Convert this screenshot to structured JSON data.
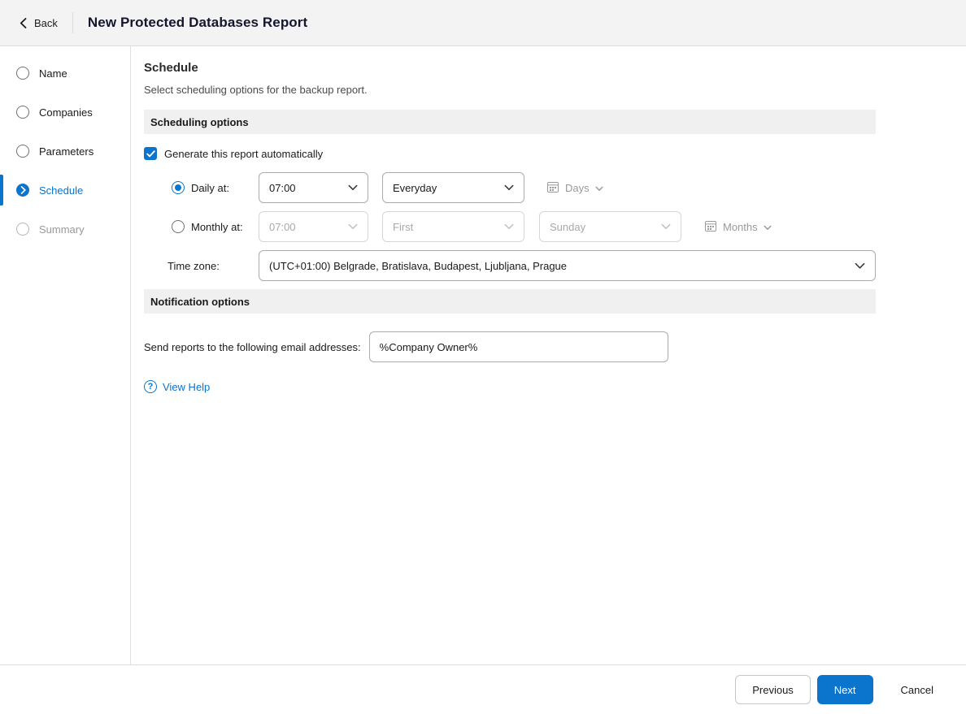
{
  "header": {
    "back_label": "Back",
    "title": "New Protected Databases Report"
  },
  "sidebar": {
    "steps": [
      {
        "label": "Name",
        "state": "pending"
      },
      {
        "label": "Companies",
        "state": "pending"
      },
      {
        "label": "Parameters",
        "state": "pending"
      },
      {
        "label": "Schedule",
        "state": "active"
      },
      {
        "label": "Summary",
        "state": "disabled"
      }
    ]
  },
  "content": {
    "title": "Schedule",
    "subtitle": "Select scheduling options for the backup report.",
    "scheduling_section": {
      "header": "Scheduling options",
      "generate_checkbox_label": "Generate this report automatically",
      "generate_checkbox_checked": true,
      "daily": {
        "label": "Daily at:",
        "selected": true,
        "time_value": "07:00",
        "frequency_value": "Everyday",
        "days_label": "Days"
      },
      "monthly": {
        "label": "Monthly at:",
        "selected": false,
        "time_value": "07:00",
        "week_value": "First",
        "day_value": "Sunday",
        "months_label": "Months"
      },
      "timezone": {
        "label": "Time zone:",
        "value": "(UTC+01:00) Belgrade, Bratislava, Budapest, Ljubljana, Prague"
      }
    },
    "notification_section": {
      "header": "Notification options",
      "email_label": "Send reports to the following email addresses:",
      "email_value": "%Company Owner%"
    },
    "help_link_label": "View Help"
  },
  "footer": {
    "previous_label": "Previous",
    "next_label": "Next",
    "cancel_label": "Cancel"
  },
  "icons": {
    "help_glyph": "?"
  },
  "colors": {
    "accent_blue": "#0b74cc",
    "header_background": "#f3f3f3",
    "section_header_background": "#f0f0f0",
    "disabled_text": "#9a9a9a"
  }
}
